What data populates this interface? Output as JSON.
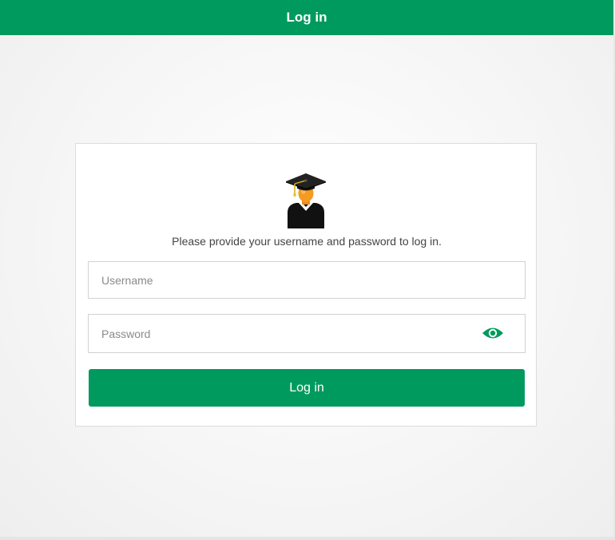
{
  "header": {
    "title": "Log in",
    "background_color": "#009a5e"
  },
  "login_card": {
    "avatar_icon": "graduate-avatar-icon",
    "prompt": "Please provide your username and password to log in.",
    "username": {
      "placeholder": "Username",
      "value": ""
    },
    "password": {
      "placeholder": "Password",
      "value": "",
      "toggle_icon": "eye-icon"
    },
    "submit_label": "Log in",
    "accent_color": "#009a5e"
  }
}
